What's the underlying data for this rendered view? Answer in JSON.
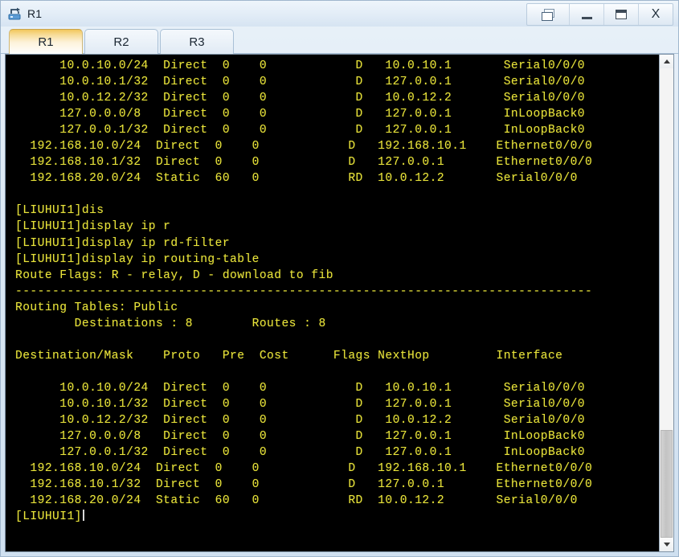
{
  "window": {
    "title": "R1",
    "icon": "router-icon",
    "controls": {
      "restore": "restore-window",
      "minimize": "–",
      "maximize": "maximize-window",
      "close": "X"
    }
  },
  "tabs": [
    {
      "label": "R1",
      "active": true
    },
    {
      "label": "R2",
      "active": false
    },
    {
      "label": "R3",
      "active": false
    }
  ],
  "terminal": {
    "prompt": "[LIUHUI1]",
    "cursor_visible": true,
    "text": "      10.0.10.0/24  Direct  0    0            D   10.0.10.1       Serial0/0/0\n      10.0.10.1/32  Direct  0    0            D   127.0.0.1       Serial0/0/0\n      10.0.12.2/32  Direct  0    0            D   10.0.12.2       Serial0/0/0\n      127.0.0.0/8   Direct  0    0            D   127.0.0.1       InLoopBack0\n      127.0.0.1/32  Direct  0    0            D   127.0.0.1       InLoopBack0\n  192.168.10.0/24  Direct  0    0            D   192.168.10.1    Ethernet0/0/0\n  192.168.10.1/32  Direct  0    0            D   127.0.0.1       Ethernet0/0/0\n  192.168.20.0/24  Static  60   0            RD  10.0.12.2       Serial0/0/0\n\n[LIUHUI1]dis\n[LIUHUI1]display ip r\n[LIUHUI1]display ip rd-filter\n[LIUHUI1]display ip routing-table\nRoute Flags: R - relay, D - download to fib\n------------------------------------------------------------------------------\nRouting Tables: Public\n        Destinations : 8        Routes : 8\n\nDestination/Mask    Proto   Pre  Cost      Flags NextHop         Interface\n\n      10.0.10.0/24  Direct  0    0            D   10.0.10.1       Serial0/0/0\n      10.0.10.1/32  Direct  0    0            D   127.0.0.1       Serial0/0/0\n      10.0.12.2/32  Direct  0    0            D   10.0.12.2       Serial0/0/0\n      127.0.0.0/8   Direct  0    0            D   127.0.0.1       InLoopBack0\n      127.0.0.1/32  Direct  0    0            D   127.0.0.1       InLoopBack0\n  192.168.10.0/24  Direct  0    0            D   192.168.10.1    Ethernet0/0/0\n  192.168.10.1/32  Direct  0    0            D   127.0.0.1       Ethernet0/0/0\n  192.168.20.0/24  Static  60   0            RD  10.0.12.2       Serial0/0/0\n"
  },
  "scrollbar": {
    "up_arrow": "scroll-up",
    "down_arrow": "scroll-down"
  },
  "colors": {
    "terminal_bg": "#000000",
    "terminal_fg": "#e8e33a",
    "active_tab_accent": "#f2c75c",
    "window_chrome": "#dbe8f4"
  }
}
